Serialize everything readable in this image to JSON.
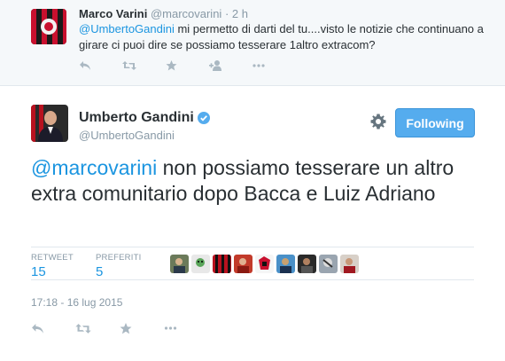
{
  "parent_tweet": {
    "name": "Marco Varini",
    "handle": "@marcovarini",
    "separator": "·",
    "time": "2 h",
    "mention": "@UmbertoGandini",
    "text": " mi permetto di darti del tu....visto le notizie che continuano a girare ci puoi dire se possiamo tesserare 1altro extracom?",
    "actions": [
      "reply-icon",
      "retweet-icon",
      "favorite-icon",
      "follow-icon",
      "more-icon"
    ]
  },
  "main_tweet": {
    "name": "Umberto Gandini",
    "handle": "@UmbertoGandini",
    "verified": true,
    "follow_label": "Following",
    "mention": "@marcovarini",
    "text": " non possiamo tesserare un altro extra comunitario dopo Bacca e Luiz Adriano",
    "stats": {
      "retweets_label": "RETWEET",
      "retweets": "15",
      "favorites_label": "PREFERITI",
      "favorites": "5"
    },
    "favoriter_count": 9,
    "timestamp": "17:18 - 16 lug 2015",
    "actions": [
      "reply-icon",
      "retweet-icon",
      "favorite-icon",
      "more-icon"
    ]
  },
  "colors": {
    "link": "#1b95e0",
    "button_bg": "#55acee",
    "muted": "#8899a6",
    "icon": "#aab8c2",
    "parent_bg": "#f5f8fa"
  }
}
